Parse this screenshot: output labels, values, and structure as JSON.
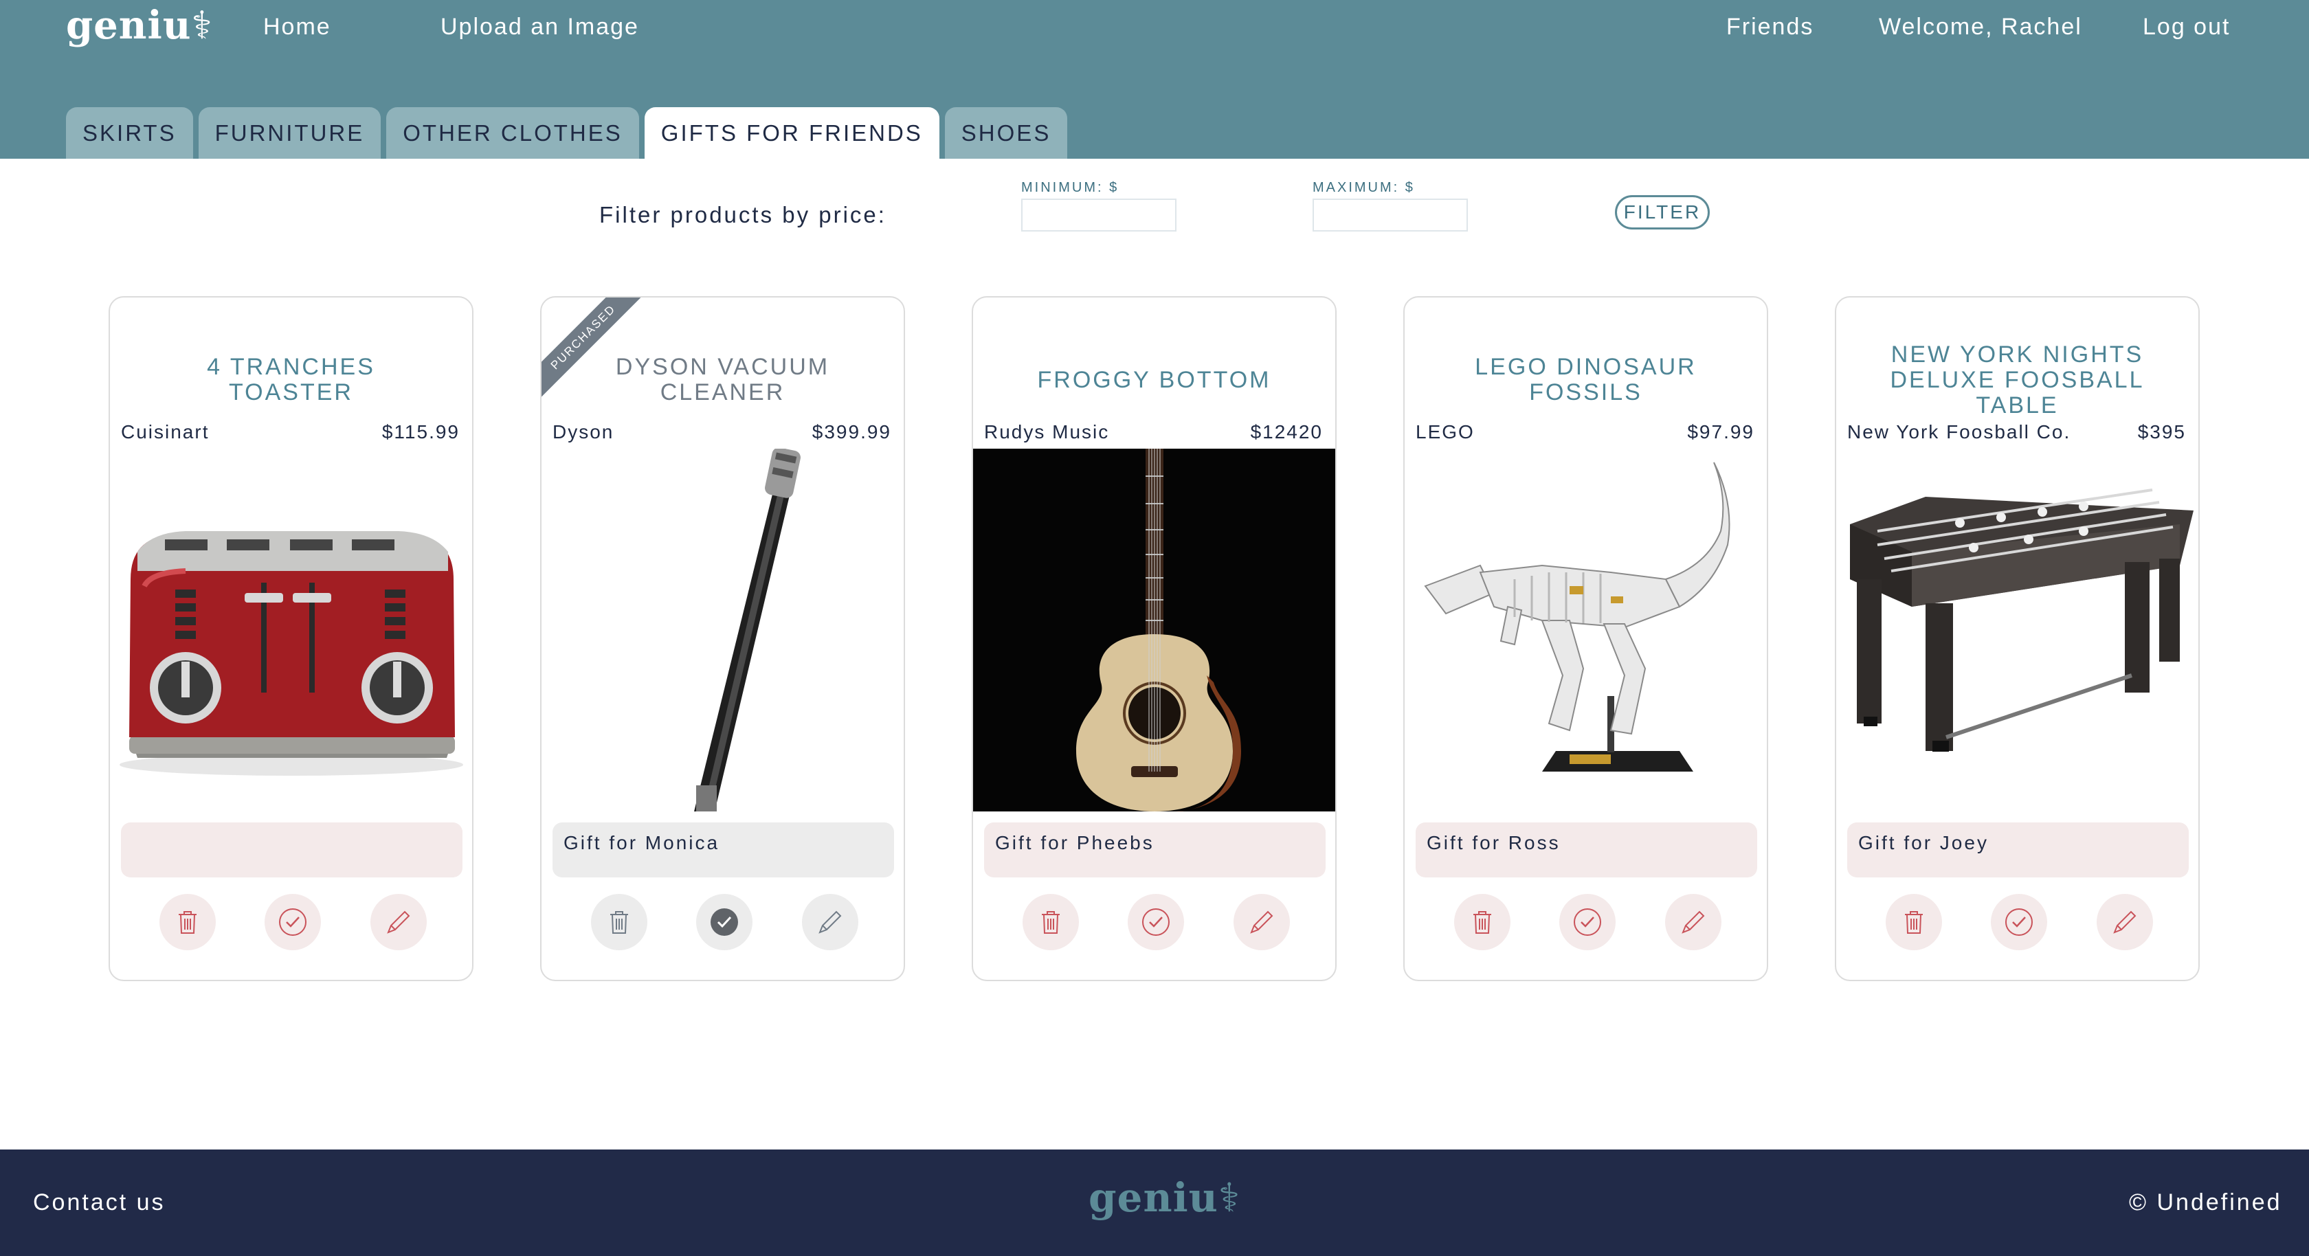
{
  "brand": {
    "name": "geniu",
    "glyph": "⚕"
  },
  "nav": {
    "home": "Home",
    "upload": "Upload an Image",
    "friends": "Friends",
    "welcome": "Welcome, Rachel",
    "logout": "Log out"
  },
  "tabs": [
    {
      "label": "SKIRTS",
      "active": false
    },
    {
      "label": "FURNITURE",
      "active": false
    },
    {
      "label": "OTHER CLOTHES",
      "active": false
    },
    {
      "label": "GIFTS FOR FRIENDS",
      "active": true
    },
    {
      "label": "SHOES",
      "active": false
    }
  ],
  "filter": {
    "label": "Filter products by price:",
    "min_label": "MINIMUM: $",
    "min_value": "",
    "max_label": "MAXIMUM: $",
    "max_value": "",
    "button": "FILTER"
  },
  "products": [
    {
      "title": "4 TRANCHES TOASTER",
      "brand": "Cuisinart",
      "price": "$115.99",
      "note": "",
      "purchased": false,
      "image": "red-toaster"
    },
    {
      "title": "DYSON VACUUM CLEANER",
      "brand": "Dyson",
      "price": "$399.99",
      "note": "Gift for Monica",
      "purchased": true,
      "ribbon": "PURCHASED",
      "image": "vacuum-wand"
    },
    {
      "title": "FROGGY BOTTOM",
      "brand": "Rudys Music",
      "price": "$12420",
      "note": "Gift for Pheebs",
      "purchased": false,
      "image": "acoustic-guitar"
    },
    {
      "title": "LEGO DINOSAUR FOSSILS",
      "brand": "LEGO",
      "price": "$97.99",
      "note": "Gift for Ross",
      "purchased": false,
      "image": "dinosaur-skeleton"
    },
    {
      "title": "NEW YORK NIGHTS DELUXE FOOSBALL TABLE",
      "brand": "New York Foosball Co.",
      "price": "$395",
      "note": "Gift for Joey",
      "purchased": false,
      "image": "foosball-table"
    }
  ],
  "footer": {
    "contact": "Contact us",
    "copyright": "© Undefined"
  },
  "colors": {
    "header": "#5c8b97",
    "tab": "#8fb2ba",
    "footer": "#212a48",
    "title_text": "#4d8495",
    "note_bg": "#f4eaea",
    "action_icon": "#c9535a",
    "purchased_grey": "#707b86"
  }
}
